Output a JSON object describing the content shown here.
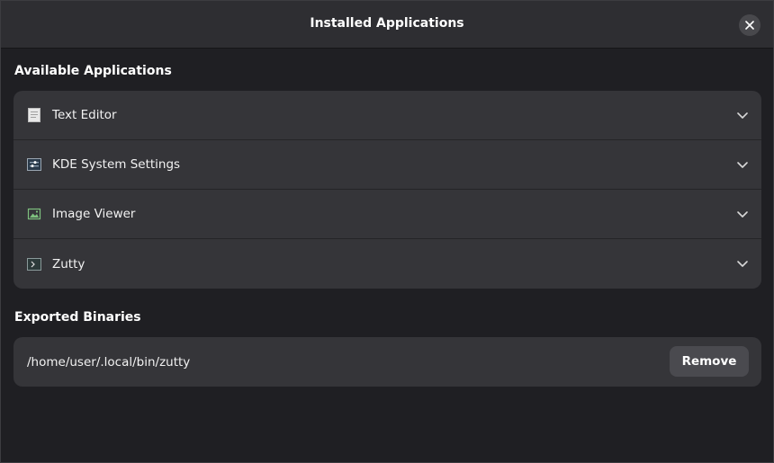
{
  "window": {
    "title": "Installed Applications",
    "close_icon": "close-icon"
  },
  "sections": {
    "apps_title": "Available Applications",
    "binaries_title": "Exported Binaries"
  },
  "apps": [
    {
      "label": "Text Editor",
      "icon": "text-editor-icon"
    },
    {
      "label": "KDE System Settings",
      "icon": "settings-icon"
    },
    {
      "label": "Image Viewer",
      "icon": "image-viewer-icon"
    },
    {
      "label": "Zutty",
      "icon": "terminal-icon"
    }
  ],
  "binaries": [
    {
      "path": "/home/user/.local/bin/zutty",
      "action_label": "Remove"
    }
  ],
  "colors": {
    "background": "#1f1f23",
    "card": "#353539",
    "button": "#4a4a4f"
  }
}
